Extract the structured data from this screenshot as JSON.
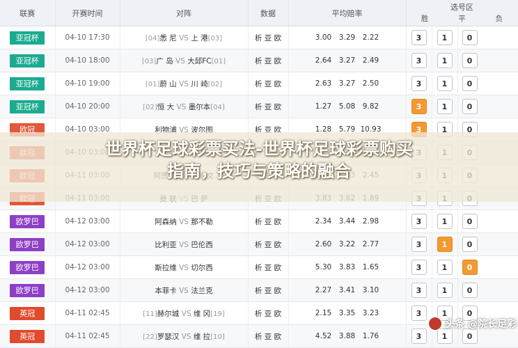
{
  "headers": {
    "league": "联赛",
    "time": "开赛时间",
    "match": "对阵",
    "data": "数据",
    "odds": "平均赔率",
    "select": "选号区",
    "win": "胜",
    "draw": "平",
    "loss": "负"
  },
  "colors": {
    "亚冠杯": "#1bab8e",
    "欧冠": "#e1583a",
    "欧罗巴": "#8e3fc6",
    "英冠": "#e14b2d",
    "highlight": "#f39a32"
  },
  "rows": [
    {
      "league": "亚冠杯",
      "time": "04-10 17:30",
      "home_rank": "[04]",
      "home": "悉 尼",
      "away": "上 港",
      "away_rank": "[03]",
      "data": "析 亚 欧",
      "odds": [
        "3.00",
        "3.29",
        "2.22"
      ],
      "sel": [
        "3",
        "1",
        "0"
      ],
      "on": [
        false,
        false,
        false
      ]
    },
    {
      "league": "亚冠杯",
      "time": "04-10 18:00",
      "home_rank": "[03]",
      "home": "广 岛",
      "away": "大邱FC",
      "away_rank": "[01]",
      "data": "析 亚 欧",
      "odds": [
        "2.64",
        "3.27",
        "2.49"
      ],
      "sel": [
        "3",
        "1",
        "0"
      ],
      "on": [
        false,
        false,
        false
      ]
    },
    {
      "league": "亚冠杯",
      "time": "04-10 19:00",
      "home_rank": "[01]",
      "home": "蔚 山",
      "away": "川 崎",
      "away_rank": "[02]",
      "data": "析 亚 欧",
      "odds": [
        "2.63",
        "3.27",
        "2.50"
      ],
      "sel": [
        "3",
        "1",
        "0"
      ],
      "on": [
        false,
        false,
        false
      ]
    },
    {
      "league": "亚冠杯",
      "time": "04-10 20:00",
      "home_rank": "[02]",
      "home": "恒 大",
      "away": "墨尔本",
      "away_rank": "[04]",
      "data": "析 亚 欧",
      "odds": [
        "1.27",
        "5.08",
        "9.82"
      ],
      "sel": [
        "3",
        "1",
        "0"
      ],
      "on": [
        true,
        false,
        false
      ]
    },
    {
      "league": "欧冠",
      "time": "04-10 03:00",
      "home_rank": "",
      "home": "利物浦",
      "away": "波尔图",
      "away_rank": "",
      "data": "析 亚 欧",
      "odds": [
        "1.28",
        "5.79",
        "10.93"
      ],
      "sel": [
        "3",
        "1",
        "0"
      ],
      "on": [
        true,
        false,
        false
      ]
    },
    {
      "league": "欧冠",
      "time": "04-10 03:00",
      "home_rank": "",
      "home": "热 刺",
      "away": "曼 城",
      "away_rank": "",
      "data": "析 亚 欧",
      "odds": [
        "3.22",
        "3.48",
        "2.16"
      ],
      "sel": [
        "3",
        "1",
        "0"
      ],
      "on": [
        false,
        false,
        false
      ]
    },
    {
      "league": "欧冠",
      "time": "04-11 03:00",
      "home_rank": "",
      "home": "阿贾克斯",
      "away": "尤 文",
      "away_rank": "",
      "data": "析 亚 欧",
      "odds": [
        "2.84",
        "3.33",
        "2.45"
      ],
      "sel": [
        "3",
        "1",
        "0"
      ],
      "on": [
        false,
        false,
        false
      ]
    },
    {
      "league": "欧冠",
      "time": "04-11 03:00",
      "home_rank": "",
      "home": "曼 联",
      "away": "巴 萨",
      "away_rank": "",
      "data": "析 亚 欧",
      "odds": [
        "3.83",
        "3.62",
        "1.89"
      ],
      "sel": [
        "3",
        "1",
        "0"
      ],
      "on": [
        false,
        false,
        false
      ]
    },
    {
      "league": "欧罗巴",
      "time": "04-12 03:00",
      "home_rank": "",
      "home": "阿森纳",
      "away": "那不勒",
      "away_rank": "",
      "data": "析 亚 欧",
      "odds": [
        "2.34",
        "3.44",
        "2.98"
      ],
      "sel": [
        "3",
        "1",
        "0"
      ],
      "on": [
        false,
        false,
        false
      ]
    },
    {
      "league": "欧罗巴",
      "time": "04-12 03:00",
      "home_rank": "",
      "home": "比利亚",
      "away": "巴伦西",
      "away_rank": "",
      "data": "析 亚 欧",
      "odds": [
        "2.60",
        "3.22",
        "2.77"
      ],
      "sel": [
        "3",
        "1",
        "0"
      ],
      "on": [
        false,
        true,
        false
      ]
    },
    {
      "league": "欧罗巴",
      "time": "04-12 03:00",
      "home_rank": "",
      "home": "斯拉维",
      "away": "切尔西",
      "away_rank": "",
      "data": "析 亚 欧",
      "odds": [
        "5.30",
        "3.83",
        "1.65"
      ],
      "sel": [
        "3",
        "1",
        "0"
      ],
      "on": [
        false,
        false,
        true
      ]
    },
    {
      "league": "欧罗巴",
      "time": "04-12 03:00",
      "home_rank": "",
      "home": "本菲卡",
      "away": "法兰克",
      "away_rank": "",
      "data": "析 亚 欧",
      "odds": [
        "2.27",
        "3.41",
        "3.10"
      ],
      "sel": [
        "3",
        "1",
        "0"
      ],
      "on": [
        false,
        false,
        false
      ]
    },
    {
      "league": "英冠",
      "time": "04-11 02:45",
      "home_rank": "[11]",
      "home": "赫尔城",
      "away": "维 冈",
      "away_rank": "[19]",
      "data": "析 亚 欧",
      "odds": [
        "2.15",
        "3.35",
        "3.23"
      ],
      "sel": [
        "3",
        "1",
        "0"
      ],
      "on": [
        false,
        false,
        false
      ]
    },
    {
      "league": "英冠",
      "time": "04-11 02:45",
      "home_rank": "[22]",
      "home": "罗瑟汉",
      "away": "维 拉",
      "away_rank": "[10]",
      "data": "析 亚 欧",
      "odds": [
        "4.52",
        "3.88",
        "1.76"
      ],
      "sel": [
        "3",
        "1",
        "0"
      ],
      "on": [
        false,
        false,
        false
      ]
    }
  ],
  "overlay": {
    "line1": "世界杯足球彩票买法-世界杯足球彩票购买",
    "line2": "指南，技巧与策略的融合"
  },
  "watermark": "头条 @院长足彩"
}
